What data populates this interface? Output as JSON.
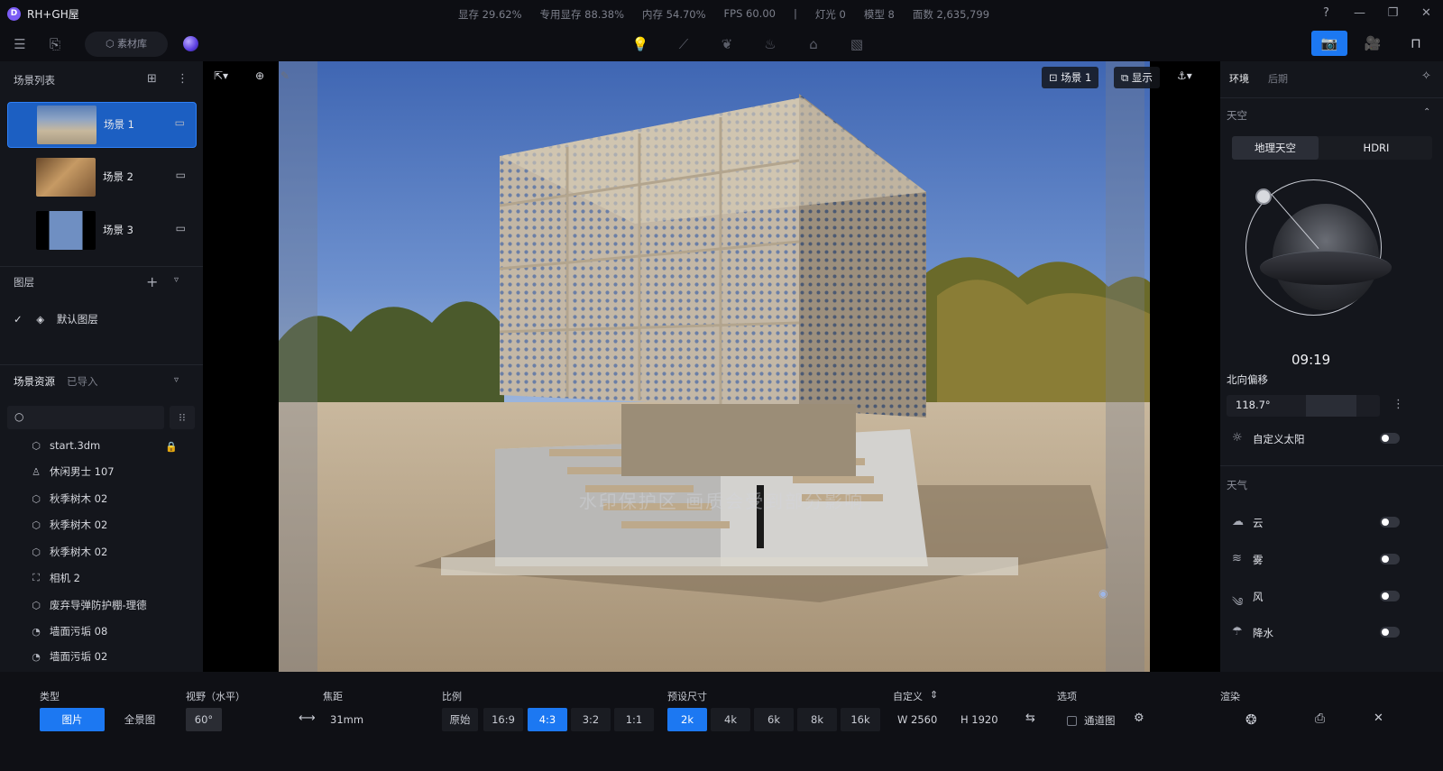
{
  "app": {
    "title": "RH+GH屋",
    "logo_letter": "D"
  },
  "stats": [
    "显存 29.62%",
    "专用显存 88.38%",
    "内存 54.70%",
    "FPS 60.00",
    "|",
    "灯光 0",
    "模型 8",
    "面数 2,635,799"
  ],
  "window_controls": {
    "help": "?",
    "minimize": "—",
    "restore": "❐",
    "close": "✕"
  },
  "toolbar": {
    "material_lib": "素材库"
  },
  "left": {
    "scene_list_title": "场景列表",
    "scenes": [
      {
        "label": "场景 1",
        "active": true
      },
      {
        "label": "场景 2",
        "active": false
      },
      {
        "label": "场景 3",
        "active": false
      }
    ],
    "layers_title": "图层",
    "default_layer": "默认图层",
    "assets_tab": "场景资源",
    "imported_tab": "已导入",
    "assets": [
      {
        "label": "start.3dm",
        "icon": "cube-icon"
      },
      {
        "label": "休闲男士 107",
        "icon": "person-icon"
      },
      {
        "label": "秋季树木 02",
        "icon": "cube-icon"
      },
      {
        "label": "秋季树木 02",
        "icon": "cube-icon"
      },
      {
        "label": "秋季树木 02",
        "icon": "cube-icon"
      },
      {
        "label": "相机 2",
        "icon": "camera-icon"
      },
      {
        "label": "废弃导弹防护棚-理德",
        "icon": "cube-icon"
      },
      {
        "label": "墙面污垢 08",
        "icon": "decal-icon"
      },
      {
        "label": "墙面污垢 02",
        "icon": "decal-icon"
      }
    ]
  },
  "viewport": {
    "scene_chip": "场景 1",
    "display_chip": "显示",
    "watermark": "水印保护区  画质会受到部分影响"
  },
  "right": {
    "tab_env": "环境",
    "tab_post": "后期",
    "sky_title": "天空",
    "sky_geo": "地理天空",
    "sky_hdri": "HDRI",
    "time": "09:19",
    "north_offset_label": "北向偏移",
    "north_offset_value": "118.7°",
    "custom_sun": "自定义太阳",
    "weather_title": "天气",
    "weather": [
      {
        "label": "云",
        "icon": "cloud-icon"
      },
      {
        "label": "雾",
        "icon": "fog-icon"
      },
      {
        "label": "风",
        "icon": "wind-icon"
      },
      {
        "label": "降水",
        "icon": "rain-icon"
      }
    ]
  },
  "bottom": {
    "type_label": "类型",
    "type_image": "图片",
    "type_panorama": "全景图",
    "fov_label": "视野（水平）",
    "fov_value": "60°",
    "focal_label": "焦距",
    "focal_value": "31mm",
    "ratio_label": "比例",
    "ratios": [
      "原始",
      "16:9",
      "4:3",
      "3:2",
      "1:1"
    ],
    "ratio_active": "4:3",
    "preset_label": "预设尺寸",
    "presets": [
      "2k",
      "4k",
      "6k",
      "8k",
      "16k"
    ],
    "preset_active": "2k",
    "custom_label": "自定义",
    "width": "W  2560",
    "height": "H  1920",
    "options_label": "选项",
    "channel_map": "通道图",
    "render_label": "渲染"
  },
  "colors": {
    "accent": "#1c78f2",
    "panel": "#14161c",
    "background": "#0c0d12"
  }
}
